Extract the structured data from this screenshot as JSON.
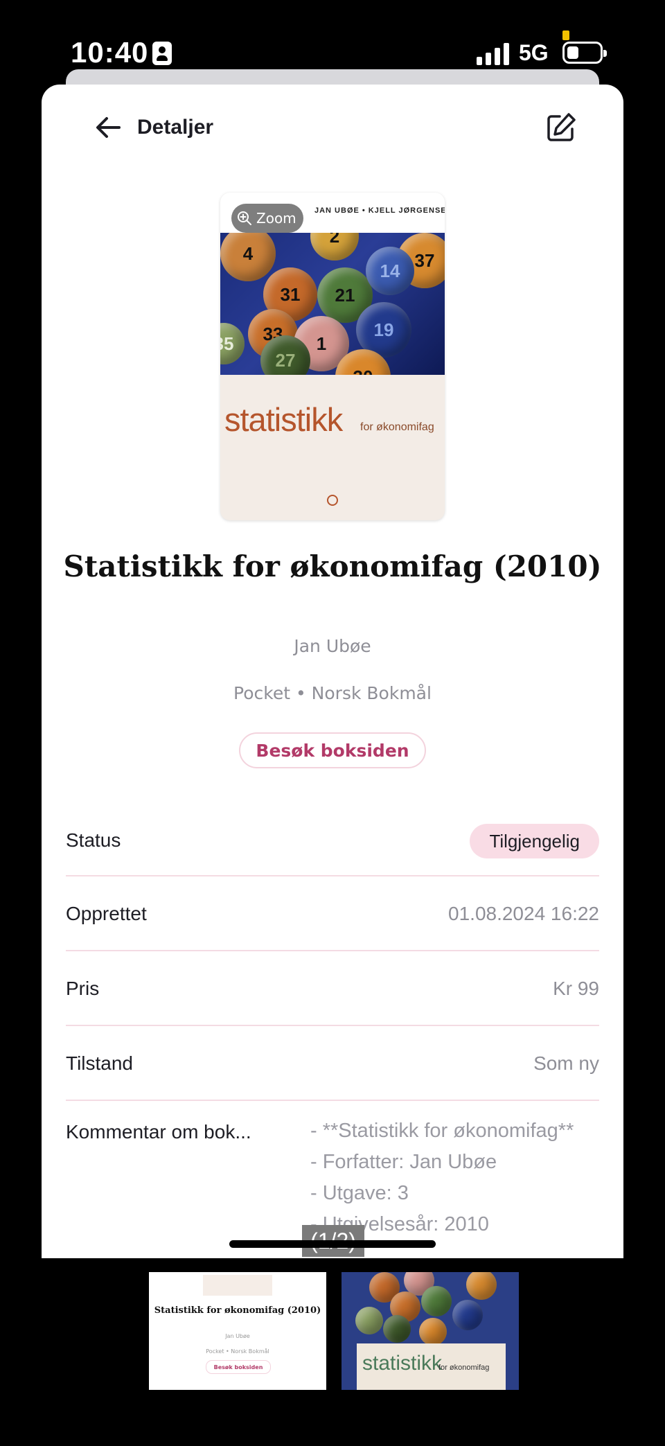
{
  "status_bar": {
    "time": "10:40",
    "network": "5G"
  },
  "header": {
    "title": "Detaljer"
  },
  "cover": {
    "zoom_label": "Zoom",
    "authors": "JAN UBØE • KJELL JØRGENSEN",
    "title": "statistikk",
    "subtitle": "for økonomifag",
    "ball_numbers": [
      "4",
      "2",
      "37",
      "31",
      "21",
      "14",
      "33",
      "1",
      "19",
      "35",
      "27",
      "30"
    ]
  },
  "book": {
    "title": "Statistikk for økonomifag (2010)",
    "author": "Jan Ubøe",
    "format": "Pocket • Norsk Bokmål",
    "visit_button": "Besøk boksiden"
  },
  "details": {
    "status_label": "Status",
    "status_value": "Tilgjengelig",
    "created_label": "Opprettet",
    "created_value": "01.08.2024 16:22",
    "price_label": "Pris",
    "price_value": "Kr 99",
    "condition_label": "Tilstand",
    "condition_value": "Som ny",
    "comment_label": "Kommentar om bok...",
    "comment_value": "- **Statistikk for økonomifag**\n- Forfatter: Jan Ubøe\n- Utgave: 3\n- Utgivelsesår: 2010"
  },
  "gallery": {
    "page_indicator": "(1/2)",
    "thumb1": {
      "title": "Statistikk for økonomifag (2010)",
      "author": "Jan Ubøe",
      "format": "Pocket • Norsk Bokmål",
      "button": "Besøk boksiden"
    },
    "thumb2": {
      "title": "statistikk",
      "subtitle": "for økonomifag"
    }
  },
  "colors": {
    "accent": "#b23a68",
    "badge_bg": "#f9dce5",
    "divider": "#f4dbe3",
    "cover_title": "#b5552c"
  }
}
